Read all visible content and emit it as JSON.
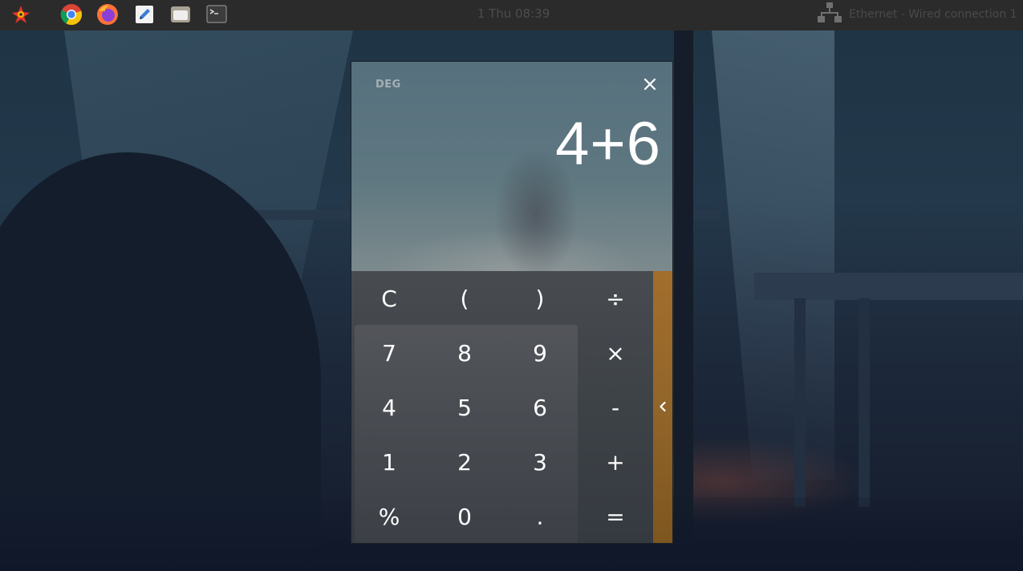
{
  "panel": {
    "clock": "1 Thu 08:39",
    "network_label": "Ethernet - Wired connection 1",
    "launchers": [
      {
        "name": "system-menu-icon"
      },
      {
        "name": "chrome-icon"
      },
      {
        "name": "firefox-icon"
      },
      {
        "name": "text-editor-icon"
      },
      {
        "name": "file-manager-icon"
      },
      {
        "name": "terminal-icon"
      }
    ]
  },
  "calculator": {
    "angle_mode": "DEG",
    "expression": "4+6",
    "keys": [
      [
        "C",
        "(",
        ")",
        "÷"
      ],
      [
        "7",
        "8",
        "9",
        "×"
      ],
      [
        "4",
        "5",
        "6",
        "-"
      ],
      [
        "1",
        "2",
        "3",
        "+"
      ],
      [
        "%",
        "0",
        ".",
        "="
      ]
    ],
    "side_panel_icon": "chevron-left-icon"
  },
  "colors": {
    "panel_bg": "#2b2b2b",
    "accent_side_panel": "#92652a",
    "display_text": "#ffffff"
  }
}
